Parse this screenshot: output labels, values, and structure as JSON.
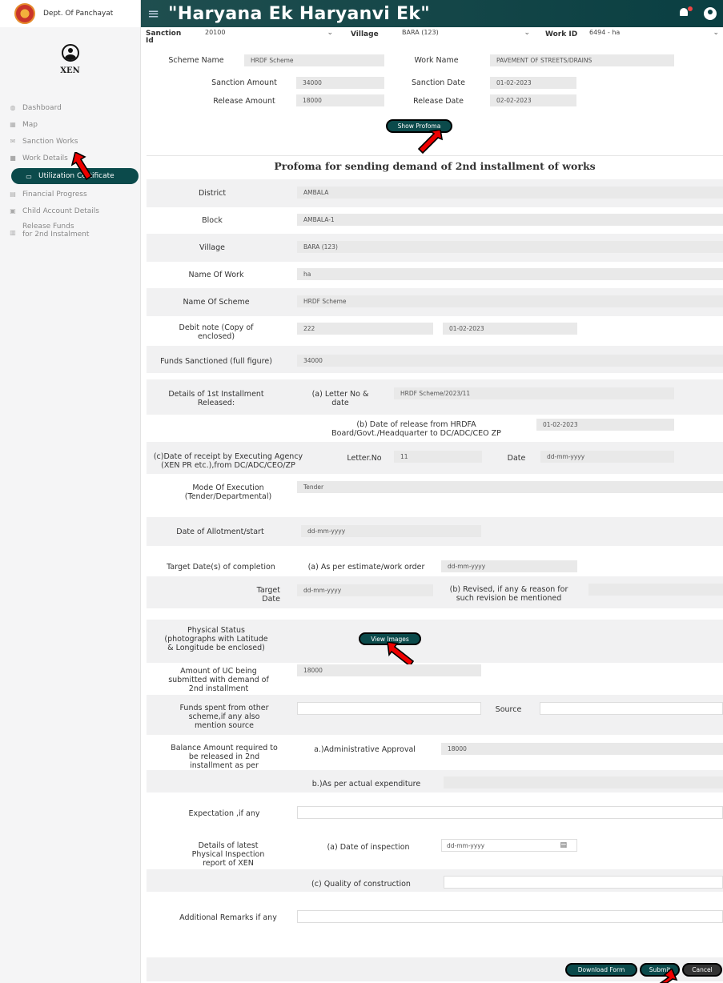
{
  "sidebar": {
    "dept": "Dept. Of Panchayat",
    "role": "XEN",
    "items": [
      {
        "label": "Dashboard",
        "icon": "palette-icon"
      },
      {
        "label": "Map",
        "icon": "map-icon"
      },
      {
        "label": "Sanction Works",
        "icon": "envelope-icon"
      },
      {
        "label": "Work Details",
        "icon": "briefcase-icon"
      },
      {
        "label": "Utilization Certificate",
        "icon": "monitor-icon"
      },
      {
        "label": "Financial Progress",
        "icon": "chart-icon"
      },
      {
        "label": "Child Account Details",
        "icon": "id-card-icon"
      },
      {
        "label1": "Release Funds",
        "label2": "for 2nd Instalment",
        "icon": "money-icon"
      }
    ]
  },
  "header": {
    "title": "\"Haryana Ek Haryanvi Ek\""
  },
  "filters": {
    "sanction_label": "Sanction",
    "sanction_label2": "Id",
    "sanction_value": "20100",
    "village_label": "Village",
    "village_value": "BARA (123)",
    "work_label": "Work ID",
    "work_value": "6494 - ha"
  },
  "info": {
    "scheme_name_label": "Scheme Name",
    "scheme_name": "HRDF Scheme",
    "work_name_label": "Work Name",
    "work_name": "PAVEMENT OF STREETS/DRAINS",
    "sanction_amount_label": "Sanction Amount",
    "sanction_amount": "34000",
    "sanction_date_label": "Sanction Date",
    "sanction_date": "01-02-2023",
    "release_amount_label": "Release Amount",
    "release_amount": "18000",
    "release_date_label": "Release Date",
    "release_date": "02-02-2023",
    "show_profoma": "Show Profoma"
  },
  "form": {
    "title": "Profoma for sending demand of 2nd installment of works",
    "district_label": "District",
    "district": "AMBALA",
    "block_label": "Block",
    "block": "AMBALA-1",
    "village_label": "Village",
    "village": "BARA (123)",
    "work_label": "Name Of Work",
    "work": "ha",
    "scheme_label": "Name Of Scheme",
    "scheme": "HRDF Scheme",
    "debit_label1": "Debit note (Copy of",
    "debit_label2": "enclosed)",
    "debit_value": "222",
    "debit_date": "01-02-2023",
    "funds_sanctioned_label": "Funds Sanctioned (full figure)",
    "funds_sanctioned": "34000",
    "first_inst_label1": "Details of 1st Installment",
    "first_inst_label2": "Released:",
    "letter_label1": "(a) Letter No &",
    "letter_label2": "date",
    "letter_value": "HRDF Scheme/2023/11",
    "release_from1": "(b) Date of release from HRDFA",
    "release_from2": "Board/Govt./Headquarter to DC/ADC/CEO ZP",
    "release_from_value": "01-02-2023",
    "receipt_label1": "(c)Date of receipt by Executing Agency",
    "receipt_label2": "(XEN PR etc.),from DC/ADC/CEO/ZP",
    "letterno_label": "Letter.No",
    "letterno_value": "11",
    "date_label": "Date",
    "date_placeholder": "dd-mm-yyyy",
    "mode_label1": "Mode Of Execution",
    "mode_label2": "(Tender/Departmental)",
    "mode_value": "Tender",
    "allotment_label": "Date of Allotment/start",
    "allotment_placeholder": "dd-mm-yyyy",
    "target_label": "Target Date(s) of completion",
    "estimate_label": "(a) As per estimate/work order",
    "estimate_placeholder": "dd-mm-yyyy",
    "target_date_label1": "Target",
    "target_date_label2": "Date",
    "target_date_placeholder": "dd-mm-yyyy",
    "revised_label1": "(b) Revised, if any & reason for",
    "revised_label2": "such revision be mentioned",
    "physical_label1": "Physical Status",
    "physical_label2": "(photographs with Latitude",
    "physical_label3": "& Longitude be enclosed)",
    "view_images": "View Images",
    "uc_label1": "Amount of UC being",
    "uc_label2": "submitted with demand of",
    "uc_label3": "2nd installment",
    "uc_value": "18000",
    "funds_other1": "Funds spent from other",
    "funds_other2": "scheme,if any also",
    "funds_other3": "mention source",
    "source_label": "Source",
    "balance1": "Balance Amount required to",
    "balance2": "be released in 2nd",
    "balance3": "installment as per",
    "admin_label": "a.)Administrative Approval",
    "admin_value": "18000",
    "actual_label": "b.)As per actual expenditure",
    "expectation_label": "Expectation ,if any",
    "inspect1": "Details of latest",
    "inspect2": "Physical Inspection",
    "inspect3": "report of XEN",
    "insp_date_label": "(a) Date of inspection",
    "insp_date_placeholder": "dd-mm-yyyy",
    "quality_label": "(c) Quality of construction",
    "remarks_label": "Additional Remarks if any",
    "download": "Download Form",
    "submit": "Submit",
    "cancel": "Cancel"
  }
}
